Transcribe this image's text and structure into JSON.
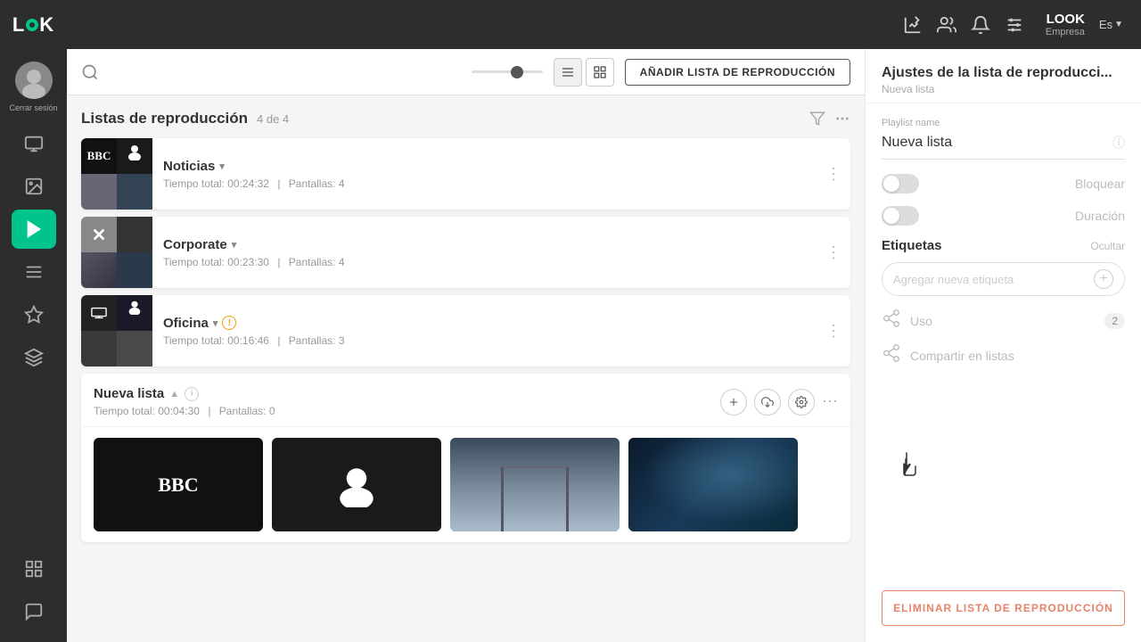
{
  "logo": {
    "text": "LOOK",
    "brand": "LOOK",
    "empresa": "Empresa",
    "lang": "Es"
  },
  "header": {
    "brand": "LOOK",
    "empresa": "Empresa",
    "lang": "Es"
  },
  "sidebar": {
    "logout": "Cerrar sesión",
    "items": [
      {
        "id": "screen",
        "icon": "screen"
      },
      {
        "id": "image",
        "icon": "image"
      },
      {
        "id": "playlist",
        "icon": "playlist",
        "active": true
      },
      {
        "id": "list",
        "icon": "list"
      },
      {
        "id": "star",
        "icon": "star"
      },
      {
        "id": "layers",
        "icon": "layers"
      },
      {
        "id": "comment",
        "icon": "comment"
      },
      {
        "id": "grid",
        "icon": "grid"
      }
    ]
  },
  "toolbar": {
    "add_label": "AÑADIR LISTA DE REPRODUCCIÓN"
  },
  "playlist_section": {
    "title": "Listas de reproducción",
    "count": "4 de 4",
    "items": [
      {
        "id": "noticias",
        "name": "Noticias",
        "time": "Tiempo total: 00:24:32",
        "screens": "Pantallas: 4"
      },
      {
        "id": "corporate",
        "name": "Corporate",
        "time": "Tiempo total: 00:23:30",
        "screens": "Pantallas: 4"
      },
      {
        "id": "oficina",
        "name": "Oficina",
        "time": "Tiempo total: 00:16:46",
        "screens": "Pantallas: 3"
      }
    ],
    "nueva": {
      "name": "Nueva lista",
      "time": "Tiempo total: 00:04:30",
      "screens": "Pantallas: 0"
    }
  },
  "right_panel": {
    "title": "Ajustes de la lista de reproducci...",
    "subtitle": "Nueva lista",
    "field_label": "Playlist name",
    "field_value": "Nueva lista",
    "bloquear": "Bloquear",
    "duracion": "Duración",
    "etiquetas": "Etiquetas",
    "ocultar": "Ocultar",
    "etiqueta_placeholder": "Agregar nueva etiqueta",
    "uso": "Uso",
    "uso_count": "2",
    "compartir": "Compartir en listas",
    "delete_label": "ELIMINAR LISTA DE REPRODUCCIÓN"
  }
}
